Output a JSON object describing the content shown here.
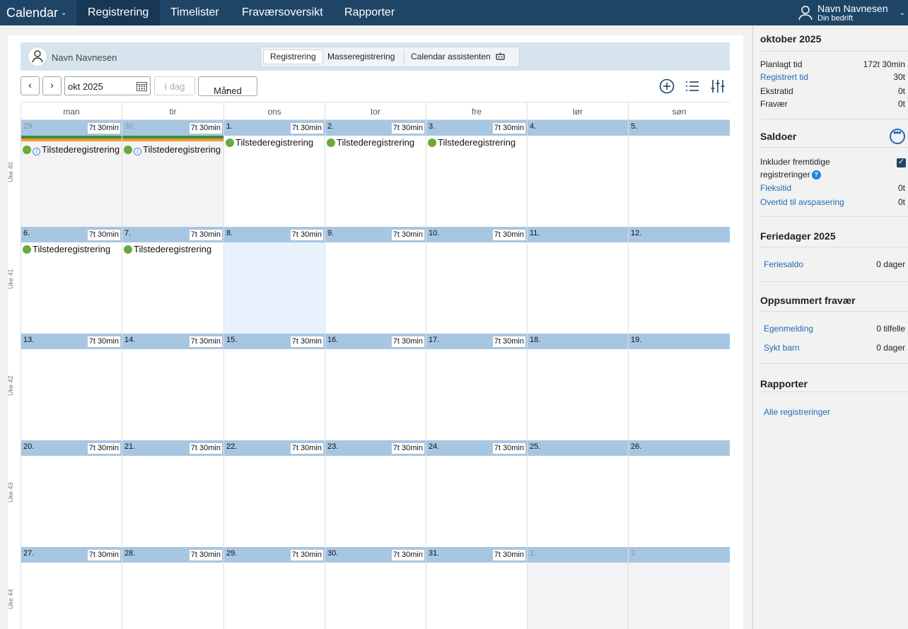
{
  "topbar": {
    "brand": "Calendar",
    "tabs": [
      {
        "label": "Registrering",
        "active": true
      },
      {
        "label": "Timelister",
        "active": false
      },
      {
        "label": "Fraværsoversikt",
        "active": false
      },
      {
        "label": "Rapporter",
        "active": false
      }
    ],
    "user_name": "Navn Navnesen",
    "user_company": "Din bedrift"
  },
  "main": {
    "user_name": "Navn Navnesen",
    "segments": [
      "Registrering",
      "Masseregistrering",
      "Calendar assistenten"
    ],
    "date_value": "okt 2025",
    "today_label": "I dag",
    "view_label": "Måned"
  },
  "calendar": {
    "weekdays": [
      "man",
      "tir",
      "ons",
      "tor",
      "fre",
      "lør",
      "søn"
    ],
    "weeks": [
      {
        "label": "Uke 40",
        "days": [
          {
            "num": "29.",
            "hours": "7t 30min",
            "muted": true,
            "grey": true,
            "stripes": true,
            "event": "Tilstederegistrering",
            "info": true
          },
          {
            "num": "30.",
            "hours": "7t 30min",
            "muted": true,
            "grey": true,
            "stripes": true,
            "event": "Tilstederegistrering",
            "info": true
          },
          {
            "num": "1.",
            "hours": "7t 30min",
            "event": "Tilstederegistrering"
          },
          {
            "num": "2.",
            "hours": "7t 30min",
            "event": "Tilstederegistrering"
          },
          {
            "num": "3.",
            "hours": "7t 30min",
            "event": "Tilstederegistrering"
          },
          {
            "num": "4.",
            "hours": ""
          },
          {
            "num": "5.",
            "hours": ""
          }
        ]
      },
      {
        "label": "Uke 41",
        "days": [
          {
            "num": "6.",
            "hours": "7t 30min",
            "event": "Tilstederegistrering"
          },
          {
            "num": "7.",
            "hours": "7t 30min",
            "event": "Tilstederegistrering"
          },
          {
            "num": "8.",
            "hours": "7t 30min",
            "today": true
          },
          {
            "num": "9.",
            "hours": "7t 30min"
          },
          {
            "num": "10.",
            "hours": "7t 30min"
          },
          {
            "num": "11.",
            "hours": ""
          },
          {
            "num": "12.",
            "hours": ""
          }
        ]
      },
      {
        "label": "Uke 42",
        "days": [
          {
            "num": "13.",
            "hours": "7t 30min"
          },
          {
            "num": "14.",
            "hours": "7t 30min"
          },
          {
            "num": "15.",
            "hours": "7t 30min"
          },
          {
            "num": "16.",
            "hours": "7t 30min"
          },
          {
            "num": "17.",
            "hours": "7t 30min"
          },
          {
            "num": "18.",
            "hours": ""
          },
          {
            "num": "19.",
            "hours": ""
          }
        ]
      },
      {
        "label": "Uke 43",
        "days": [
          {
            "num": "20.",
            "hours": "7t 30min"
          },
          {
            "num": "21.",
            "hours": "7t 30min"
          },
          {
            "num": "22.",
            "hours": "7t 30min"
          },
          {
            "num": "23.",
            "hours": "7t 30min"
          },
          {
            "num": "24.",
            "hours": "7t 30min"
          },
          {
            "num": "25.",
            "hours": ""
          },
          {
            "num": "26.",
            "hours": ""
          }
        ]
      },
      {
        "label": "Uke 44",
        "days": [
          {
            "num": "27.",
            "hours": "7t 30min"
          },
          {
            "num": "28.",
            "hours": "7t 30min"
          },
          {
            "num": "29.",
            "hours": "7t 30min"
          },
          {
            "num": "30.",
            "hours": "7t 30min"
          },
          {
            "num": "31.",
            "hours": "7t 30min"
          },
          {
            "num": "1.",
            "hours": "",
            "muted": true,
            "grey": true
          },
          {
            "num": "2.",
            "hours": "",
            "muted": true,
            "grey": true
          }
        ]
      }
    ]
  },
  "sidebar": {
    "month_title": "oktober 2025",
    "summary": [
      {
        "label": "Planlagt tid",
        "value": "172t 30min",
        "link": false
      },
      {
        "label": "Registrert tid",
        "value": "30t",
        "link": true
      },
      {
        "label": "Ekstratid",
        "value": "0t",
        "link": false
      },
      {
        "label": "Fravær",
        "value": "0t",
        "link": false
      }
    ],
    "saldoer_title": "Saldoer",
    "include_line1": "Inkluder fremtidige",
    "include_line2": "registreringer",
    "balances": [
      {
        "label": "Fleksitid",
        "value": "0t"
      },
      {
        "label": "Overtid til avspasering",
        "value": "0t"
      }
    ],
    "vacation_title": "Feriedager 2025",
    "vacation": {
      "label": "Feriesaldo",
      "value": "0 dager"
    },
    "absence_title": "Oppsummert fravær",
    "absence": [
      {
        "label": "Egenmelding",
        "value": "0 tilfelle"
      },
      {
        "label": "Sykt barn",
        "value": "0 dager"
      }
    ],
    "reports_title": "Rapporter",
    "reports_link": "Alle registreringer"
  }
}
